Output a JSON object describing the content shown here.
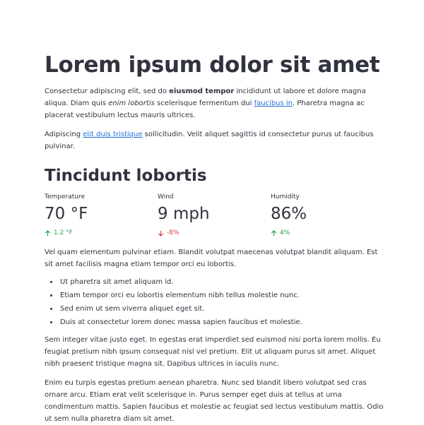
{
  "heading": "Lorem ipsum dolor sit amet",
  "intro": {
    "p1_a": "Consectetur adipiscing elit, sed do ",
    "p1_bold": "eiusmod tempor",
    "p1_b": " incididunt ut labore et dolore magna aliqua. Diam quis ",
    "p1_italic": "enim lobortis",
    "p1_c": " scelerisque fermentum dui ",
    "p1_link": "faucibus in",
    "p1_d": ". Pharetra magna ac placerat vestibulum lectus mauris ultrices.",
    "p2_a": "Adipiscing ",
    "p2_link": "elit duis tristique",
    "p2_b": " sollicitudin. Velit aliquet sagittis id consectetur purus ut faucibus pulvinar."
  },
  "subheading": "Tincidunt lobortis",
  "metrics": [
    {
      "label": "Temperature",
      "value": "70 °F",
      "delta": "1.2 °F",
      "direction": "up"
    },
    {
      "label": "Wind",
      "value": "9 mph",
      "delta": "-8%",
      "direction": "down"
    },
    {
      "label": "Humidity",
      "value": "86%",
      "delta": "4%",
      "direction": "up"
    }
  ],
  "colors": {
    "up": "#21a347",
    "down": "#e0383e",
    "link": "#1e6fd9",
    "text": "#31333f"
  },
  "body": {
    "p3": "Vel quam elementum pulvinar etiam. Blandit volutpat maecenas volutpat blandit aliquam. Est sit amet facilisis magna etiam tempor orci eu lobortis.",
    "list": [
      "Ut pharetra sit amet aliquam id.",
      "Etiam tempor orci eu lobortis elementum nibh tellus molestie nunc.",
      "Sed enim ut sem viverra aliquet eget sit.",
      "Duis at consectetur lorem donec massa sapien faucibus et molestie."
    ],
    "p4": "Sem integer vitae justo eget. In egestas erat imperdiet sed euismod nisi porta lorem mollis. Eu feugiat pretium nibh ipsum consequat nisl vel pretium. Elit ut aliquam purus sit amet. Aliquet nibh praesent tristique magna sit. Dapibus ultrices in iaculis nunc.",
    "p5": "Enim eu turpis egestas pretium aenean pharetra. Nunc sed blandit libero volutpat sed cras ornare arcu. Etiam erat velit scelerisque in. Purus semper eget duis at tellus at urna condimentum mattis. Sapien faucibus et molestie ac feugiat sed lectus vestibulum mattis. Odio ut sem nulla pharetra diam sit amet."
  }
}
